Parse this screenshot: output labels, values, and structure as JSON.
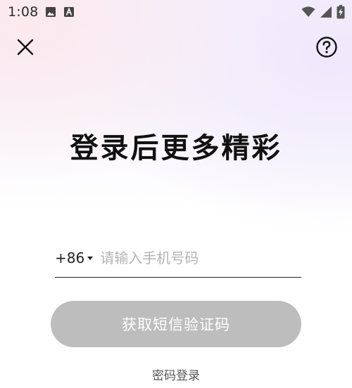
{
  "status_bar": {
    "time": "1:08",
    "icons": [
      "image-notification-icon",
      "a-notification-icon",
      "wifi-icon",
      "cellular-signal-icon",
      "battery-charging-icon"
    ]
  },
  "header": {
    "close_icon": "close-icon",
    "help_icon": "help-circle-icon"
  },
  "main": {
    "title": "登录后更多精彩",
    "country_code": "+86",
    "phone_placeholder": "请输入手机号码",
    "phone_value": "",
    "get_code_label": "获取短信验证码",
    "password_login_label": "密码登录"
  },
  "colors": {
    "button_disabled_bg": "#bdbdbd",
    "button_text": "#ffffff",
    "placeholder": "#b3b3b3",
    "title_text": "#111111"
  }
}
